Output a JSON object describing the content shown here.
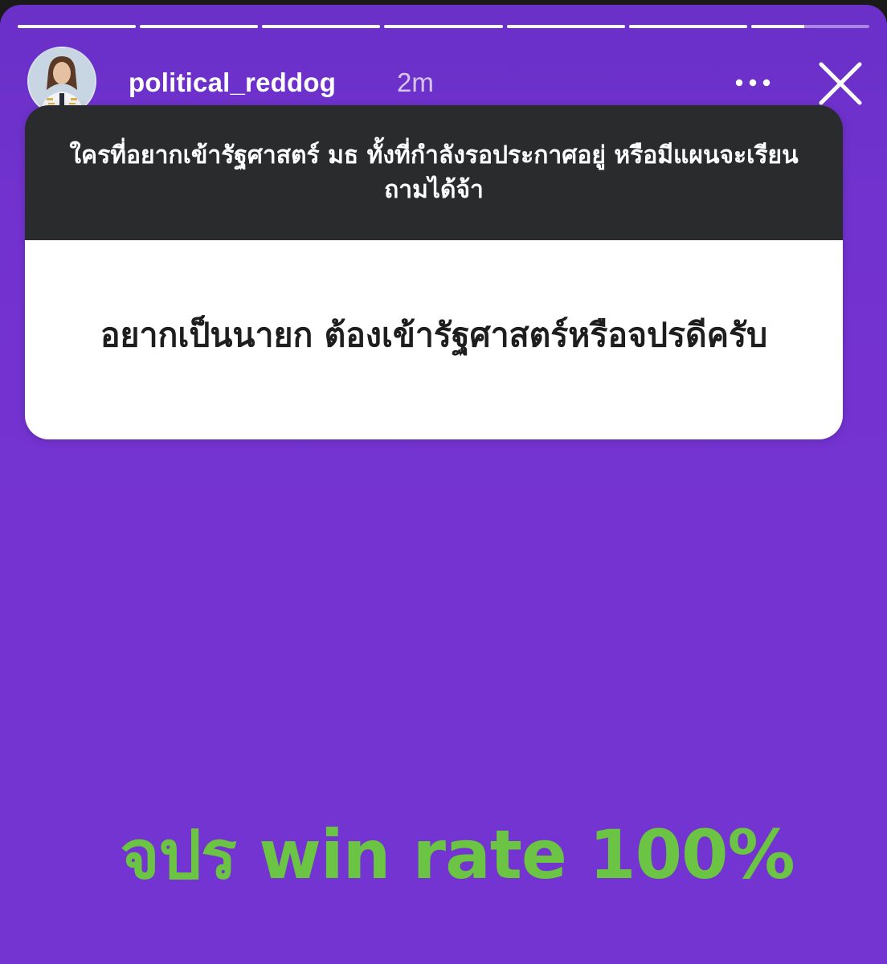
{
  "story": {
    "progress_segments": [
      1,
      1,
      1,
      1,
      1,
      1,
      0.45
    ],
    "author": {
      "username": "political_reddog",
      "time_ago": "2m",
      "avatar_icon": "profile-photo-avatar"
    },
    "more_icon": "more-dots-icon",
    "close_icon": "close-icon"
  },
  "question_sticker": {
    "prompt": "ใครที่อยากเข้ารัฐศาสตร์ มธ ทั้งที่กำลังรอประกาศอยู่ หรือมีแผนจะเรียนถามได้จ้า",
    "answer": "อยากเป็นนายก ต้องเข้ารัฐศาสตร์หรือจปรดีครับ"
  },
  "caption": {
    "text": "จปร win rate 100%",
    "color": "#6cc444"
  },
  "colors": {
    "background": "#7434d1",
    "sticker_header": "#2a2b2d",
    "sticker_body": "#ffffff"
  }
}
